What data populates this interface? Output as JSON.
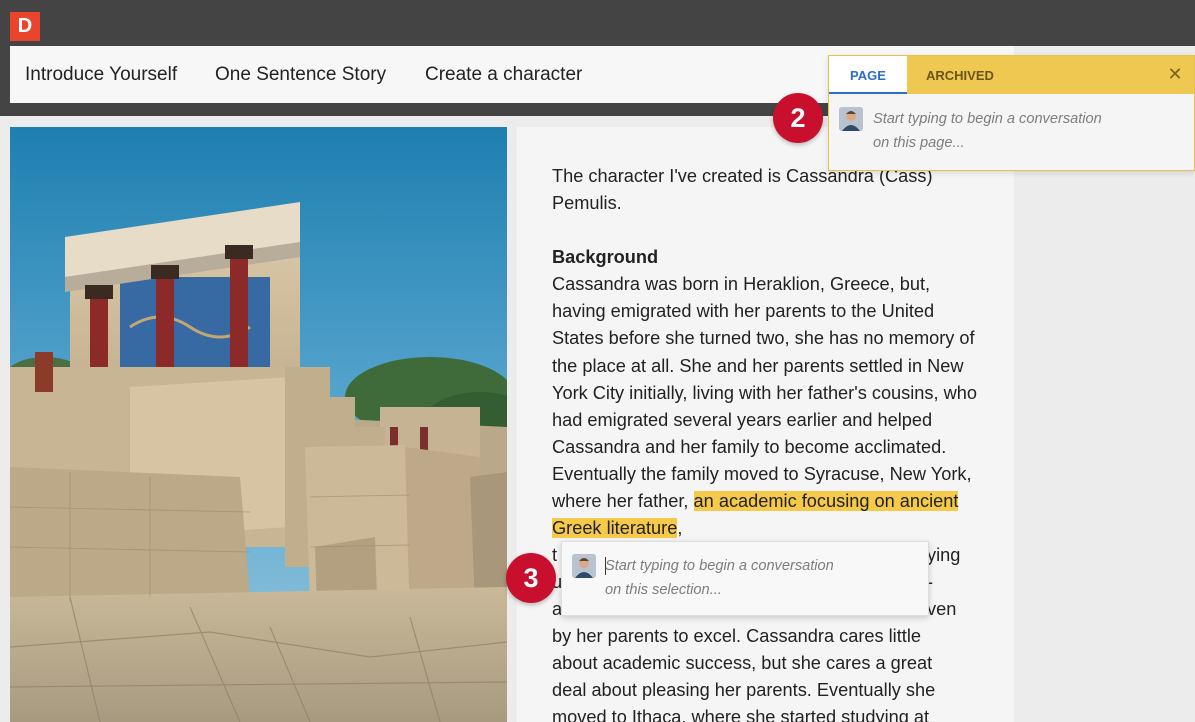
{
  "app": {
    "logo_letter": "D",
    "brand_color": "#e8452c"
  },
  "nav": {
    "items": [
      {
        "label": "Introduce Yourself"
      },
      {
        "label": "One Sentence Story"
      },
      {
        "label": "Create a character"
      }
    ]
  },
  "article": {
    "intro": "The character I've created is Cassandra (Cass) Pemulis.",
    "heading": "Background",
    "body_before_highlight": "Cassandra was born in Heraklion, Greece, but, having emigrated with her parents to the United States before she turned two, she has no memory of the place at all. She and her parents settled in New York City initially, living with her father's cousins, who had emigrated several years earlier and helped Cassandra and her family to become acclimated. Eventually the family moved to Syracuse, New York, where her father, ",
    "highlight": "an academic focusing on ancient Greek literature",
    "body_after_highlight_lines": [
      ",",
      "t",
      "ying",
      "u",
      "-",
      "a",
      "ven",
      "by her parents to excel. Cassandra cares little",
      "about academic success, but she cares a great",
      "deal about pleasing her parents. Eventually she",
      "moved to Ithaca, where she started studying at"
    ]
  },
  "comment_panel": {
    "tabs": [
      {
        "label": "PAGE",
        "active": true
      },
      {
        "label": "ARCHIVED",
        "active": false
      }
    ],
    "close_label": "✕",
    "placeholder_line1": "Start typing to begin a conversation",
    "placeholder_line2": "on this page...",
    "accent_color": "#efc852"
  },
  "selection_popup": {
    "placeholder_line1": "Start typing to begin a conversation",
    "placeholder_line2": "on this selection..."
  },
  "callouts": [
    {
      "number": "2"
    },
    {
      "number": "3"
    }
  ]
}
